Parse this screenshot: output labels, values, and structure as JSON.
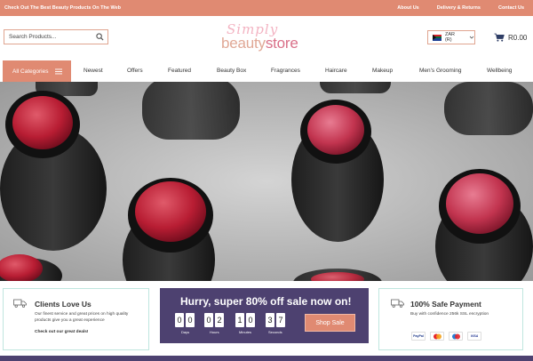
{
  "topbar": {
    "promo": "Check Out The Best Beauty Products On The Web",
    "links": [
      "About Us",
      "Delivery & Returns",
      "Contact Us"
    ]
  },
  "header": {
    "search_placeholder": "Search Products...",
    "search_icon": "search-icon",
    "logo_script": "Simply",
    "logo_word1": "beauty",
    "logo_word2": "store",
    "currency": "ZAR (R)",
    "cart_total": "R0.00",
    "cart_icon": "cart-icon"
  },
  "nav": {
    "all_categories": "All Categories",
    "items": [
      "Newest",
      "Offers",
      "Featured",
      "Beauty Box",
      "Fragrances",
      "Haircare",
      "Makeup",
      "Men's Grooming",
      "Wellbeing"
    ]
  },
  "cards": {
    "clients": {
      "title": "Clients Love Us",
      "text1": "Our finest service and great prices on high quality",
      "text2": "products give you a great experience",
      "link": "Check out our great deals!"
    },
    "sale": {
      "title": "Hurry, super 80% off sale now on!",
      "digits": [
        "0",
        "0",
        "0",
        "2",
        "1",
        "0",
        "3",
        "7"
      ],
      "labels": [
        "Days",
        "Hours",
        "Minutes",
        "Seconds"
      ],
      "button": "Shop Sale"
    },
    "safe": {
      "title": "100% Safe Payment",
      "text": "Buy with confidence 256k SSL encryption",
      "payments": [
        "PayPal",
        "",
        "",
        "VISA"
      ]
    }
  },
  "colors": {
    "accent": "#e08a72",
    "purple": "#4d4170",
    "card_border": "#bfe6df"
  }
}
